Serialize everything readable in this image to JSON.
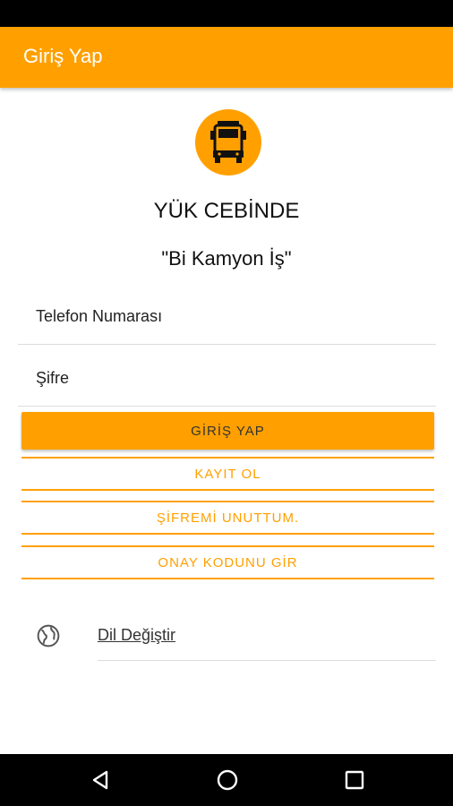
{
  "app_bar": {
    "title": "Giriş Yap"
  },
  "brand": {
    "name": "YÜK CEBİNDE",
    "slogan": "\"Bi Kamyon İş\"",
    "logo_icon": "truck-icon",
    "accent_color": "#FFA000"
  },
  "form": {
    "phone_placeholder": "Telefon Numarası",
    "password_placeholder": "Şifre"
  },
  "buttons": {
    "login": "GİRİŞ YAP",
    "register": "KAYIT OL",
    "forgot_password": "ŞİFREMİ UNUTTUM.",
    "enter_code": "ONAY KODUNU GİR"
  },
  "language": {
    "label": "Dil Değiştir",
    "icon": "globe-icon"
  },
  "nav": {
    "back_icon": "back-icon",
    "home_icon": "home-icon",
    "recents_icon": "recents-icon"
  }
}
